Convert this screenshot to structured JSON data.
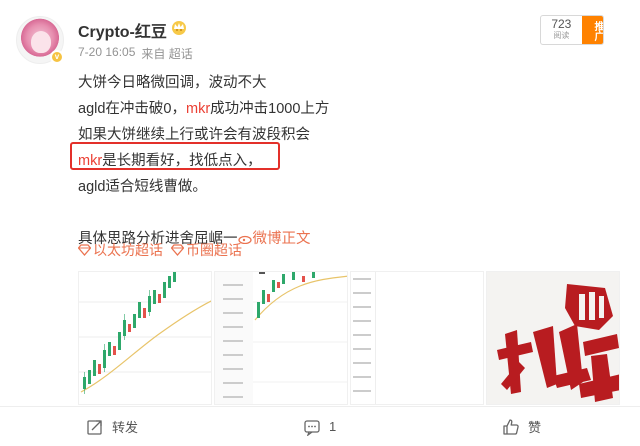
{
  "post": {
    "user_name": "Crypto-红豆",
    "date": "7-20 16:05",
    "source": "来自 超话",
    "follow_count": "723",
    "follow_label": "阅读",
    "push_label": "推广",
    "lines": {
      "l1": "大饼今日略微回调，波动不大",
      "l2_a": "agld在冲击破0，",
      "l2_b": "mkr",
      "l2_c": "成功冲击1000上方",
      "l3": "如果大饼继续上行或许会有波段积会",
      "l4_a": "mkr",
      "l4_b": "是长期看好，找低点入，",
      "l5": "agld适合短线曹做。",
      "l6_a": "具体思路分析进舍屈崌一",
      "l6_link": "微博正文"
    },
    "topics": [
      "以太坊超话",
      "币圈超话"
    ]
  },
  "images": [
    {
      "name": "candlestick-chart-thumb"
    },
    {
      "name": "price-chart-thumb"
    },
    {
      "name": "price-axis-thumb"
    },
    {
      "name": "calligraphy-thumb",
      "caption": "机会"
    }
  ],
  "actions": {
    "share_label": "转发",
    "comment_count": "1",
    "like_label": "赞"
  },
  "colors": {
    "accent": "#eb7350",
    "highlight": "#e3302a",
    "push": "#ff8200"
  }
}
